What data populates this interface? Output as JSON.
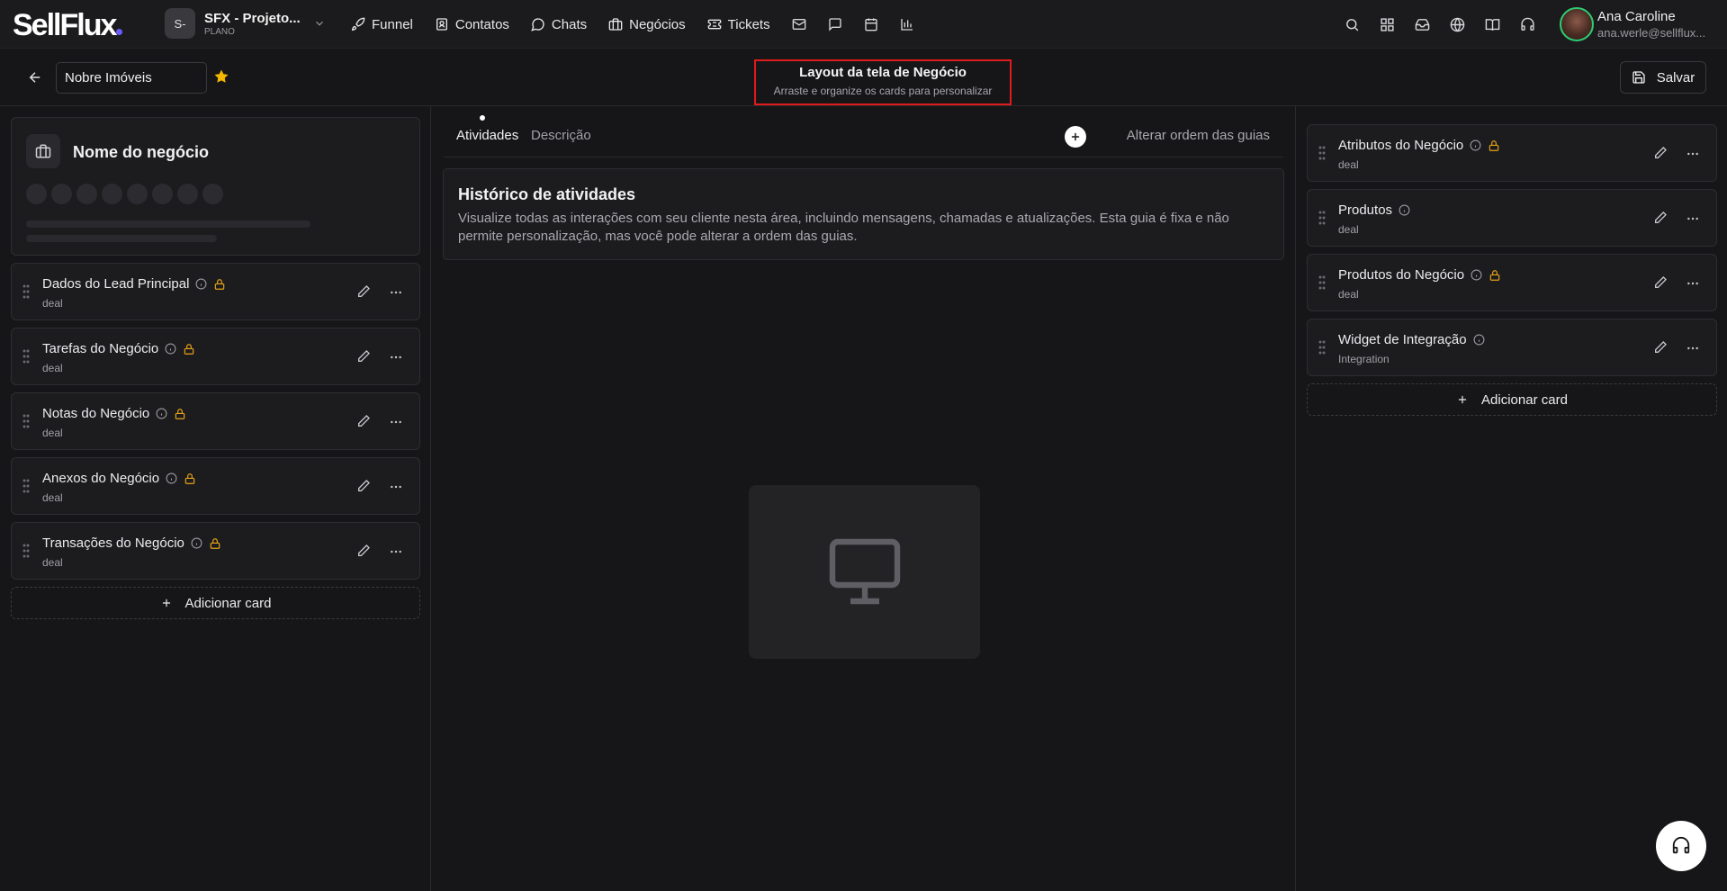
{
  "app": {
    "logo": "SellFlux"
  },
  "project": {
    "badge": "S-",
    "name": "SFX - Projeto...",
    "plan": "PLANO"
  },
  "nav": [
    {
      "label": "Funnel",
      "icon": "rocket-icon"
    },
    {
      "label": "Contatos",
      "icon": "contact-icon"
    },
    {
      "label": "Chats",
      "icon": "chat-icon"
    },
    {
      "label": "Negócios",
      "icon": "briefcase-icon"
    },
    {
      "label": "Tickets",
      "icon": "ticket-icon"
    }
  ],
  "user": {
    "name": "Ana Caroline",
    "email": "ana.werle@sellflux..."
  },
  "subheader": {
    "deal_name_value": "Nobre Imóveis",
    "title": "Layout da tela de Negócio",
    "subtitle": "Arraste e organize os cards para personalizar",
    "save_label": "Salvar"
  },
  "left": {
    "deal_title": "Nome do negócio",
    "cards": [
      {
        "title": "Dados do Lead Principal",
        "sub": "deal",
        "locked": true
      },
      {
        "title": "Tarefas do Negócio",
        "sub": "deal",
        "locked": true
      },
      {
        "title": "Notas do Negócio",
        "sub": "deal",
        "locked": true
      },
      {
        "title": "Anexos do Negócio",
        "sub": "deal",
        "locked": true
      },
      {
        "title": "Transações do Negócio",
        "sub": "deal",
        "locked": true
      }
    ],
    "add_card": "Adicionar card"
  },
  "middle": {
    "tabs": [
      {
        "label": "Atividades"
      },
      {
        "label": "Descrição"
      }
    ],
    "reorder_label": "Alterar ordem das guias",
    "history_title": "Histórico de atividades",
    "history_desc": "Visualize todas as interações com seu cliente nesta área, incluindo mensagens, chamadas e atualizações. Esta guia é fixa e não permite personalização, mas você pode alterar a ordem das guias."
  },
  "right": {
    "cards": [
      {
        "title": "Atributos do Negócio",
        "sub": "deal",
        "locked": true
      },
      {
        "title": "Produtos",
        "sub": "deal",
        "locked": false
      },
      {
        "title": "Produtos do Negócio",
        "sub": "deal",
        "locked": true
      },
      {
        "title": "Widget de Integração",
        "sub": "Integration",
        "locked": false
      }
    ],
    "add_card": "Adicionar card"
  },
  "colors": {
    "accent": "#6b5cff",
    "lock": "#e8a317",
    "star": "#f5b800",
    "highlight": "#e01b1b",
    "online": "#2ecc71"
  }
}
